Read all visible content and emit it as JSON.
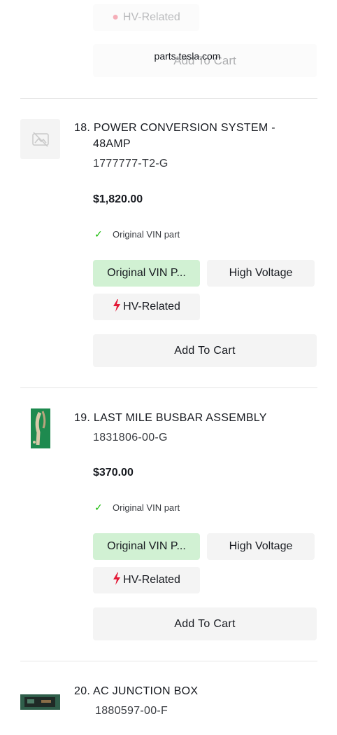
{
  "browser": {
    "url": "parts.tesla.com"
  },
  "previous_item": {
    "hv_chip": "HV-Related",
    "cart_label": "Add To Cart"
  },
  "items": [
    {
      "title_line1": "18. POWER CONVERSION SYSTEM -",
      "title_line2": "48AMP",
      "part_number": "1777777-T2-G",
      "price": "$1,820.00",
      "vin_note": "Original VIN part",
      "chip_vin": "Original VIN P...",
      "chip_voltage": "High Voltage",
      "chip_hv": "HV-Related",
      "cart_label": "Add To Cart",
      "image_icon": "image-placeholder-icon"
    },
    {
      "title_line1": "19. LAST MILE BUSBAR ASSEMBLY",
      "part_number": "1831806-00-G",
      "price": "$370.00",
      "vin_note": "Original VIN part",
      "chip_vin": "Original VIN P...",
      "chip_voltage": "High Voltage",
      "chip_hv": "HV-Related",
      "cart_label": "Add To Cart",
      "image_icon": "busbar-thumbnail"
    },
    {
      "title_line1": "20. AC JUNCTION BOX",
      "part_number": "1880597-00-F",
      "image_icon": "junction-box-thumbnail"
    }
  ],
  "colors": {
    "chip_green": "#d1f1d3",
    "chip_grey": "#f4f4f4",
    "check_green": "#12bb00",
    "bolt_red": "#e31937"
  }
}
